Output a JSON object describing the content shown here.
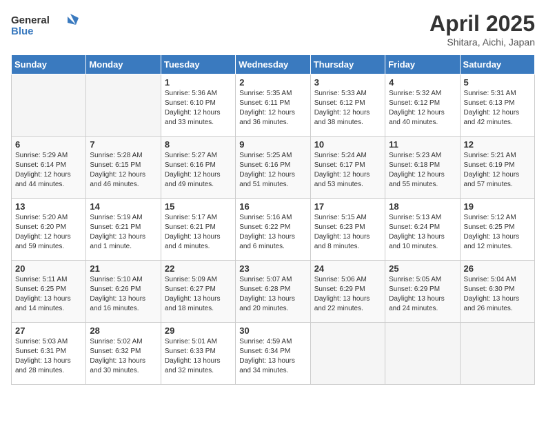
{
  "header": {
    "logo_general": "General",
    "logo_blue": "Blue",
    "title": "April 2025",
    "subtitle": "Shitara, Aichi, Japan"
  },
  "weekdays": [
    "Sunday",
    "Monday",
    "Tuesday",
    "Wednesday",
    "Thursday",
    "Friday",
    "Saturday"
  ],
  "weeks": [
    [
      {
        "day": "",
        "info": ""
      },
      {
        "day": "",
        "info": ""
      },
      {
        "day": "1",
        "info": "Sunrise: 5:36 AM\nSunset: 6:10 PM\nDaylight: 12 hours and 33 minutes."
      },
      {
        "day": "2",
        "info": "Sunrise: 5:35 AM\nSunset: 6:11 PM\nDaylight: 12 hours and 36 minutes."
      },
      {
        "day": "3",
        "info": "Sunrise: 5:33 AM\nSunset: 6:12 PM\nDaylight: 12 hours and 38 minutes."
      },
      {
        "day": "4",
        "info": "Sunrise: 5:32 AM\nSunset: 6:12 PM\nDaylight: 12 hours and 40 minutes."
      },
      {
        "day": "5",
        "info": "Sunrise: 5:31 AM\nSunset: 6:13 PM\nDaylight: 12 hours and 42 minutes."
      }
    ],
    [
      {
        "day": "6",
        "info": "Sunrise: 5:29 AM\nSunset: 6:14 PM\nDaylight: 12 hours and 44 minutes."
      },
      {
        "day": "7",
        "info": "Sunrise: 5:28 AM\nSunset: 6:15 PM\nDaylight: 12 hours and 46 minutes."
      },
      {
        "day": "8",
        "info": "Sunrise: 5:27 AM\nSunset: 6:16 PM\nDaylight: 12 hours and 49 minutes."
      },
      {
        "day": "9",
        "info": "Sunrise: 5:25 AM\nSunset: 6:16 PM\nDaylight: 12 hours and 51 minutes."
      },
      {
        "day": "10",
        "info": "Sunrise: 5:24 AM\nSunset: 6:17 PM\nDaylight: 12 hours and 53 minutes."
      },
      {
        "day": "11",
        "info": "Sunrise: 5:23 AM\nSunset: 6:18 PM\nDaylight: 12 hours and 55 minutes."
      },
      {
        "day": "12",
        "info": "Sunrise: 5:21 AM\nSunset: 6:19 PM\nDaylight: 12 hours and 57 minutes."
      }
    ],
    [
      {
        "day": "13",
        "info": "Sunrise: 5:20 AM\nSunset: 6:20 PM\nDaylight: 12 hours and 59 minutes."
      },
      {
        "day": "14",
        "info": "Sunrise: 5:19 AM\nSunset: 6:21 PM\nDaylight: 13 hours and 1 minute."
      },
      {
        "day": "15",
        "info": "Sunrise: 5:17 AM\nSunset: 6:21 PM\nDaylight: 13 hours and 4 minutes."
      },
      {
        "day": "16",
        "info": "Sunrise: 5:16 AM\nSunset: 6:22 PM\nDaylight: 13 hours and 6 minutes."
      },
      {
        "day": "17",
        "info": "Sunrise: 5:15 AM\nSunset: 6:23 PM\nDaylight: 13 hours and 8 minutes."
      },
      {
        "day": "18",
        "info": "Sunrise: 5:13 AM\nSunset: 6:24 PM\nDaylight: 13 hours and 10 minutes."
      },
      {
        "day": "19",
        "info": "Sunrise: 5:12 AM\nSunset: 6:25 PM\nDaylight: 13 hours and 12 minutes."
      }
    ],
    [
      {
        "day": "20",
        "info": "Sunrise: 5:11 AM\nSunset: 6:25 PM\nDaylight: 13 hours and 14 minutes."
      },
      {
        "day": "21",
        "info": "Sunrise: 5:10 AM\nSunset: 6:26 PM\nDaylight: 13 hours and 16 minutes."
      },
      {
        "day": "22",
        "info": "Sunrise: 5:09 AM\nSunset: 6:27 PM\nDaylight: 13 hours and 18 minutes."
      },
      {
        "day": "23",
        "info": "Sunrise: 5:07 AM\nSunset: 6:28 PM\nDaylight: 13 hours and 20 minutes."
      },
      {
        "day": "24",
        "info": "Sunrise: 5:06 AM\nSunset: 6:29 PM\nDaylight: 13 hours and 22 minutes."
      },
      {
        "day": "25",
        "info": "Sunrise: 5:05 AM\nSunset: 6:29 PM\nDaylight: 13 hours and 24 minutes."
      },
      {
        "day": "26",
        "info": "Sunrise: 5:04 AM\nSunset: 6:30 PM\nDaylight: 13 hours and 26 minutes."
      }
    ],
    [
      {
        "day": "27",
        "info": "Sunrise: 5:03 AM\nSunset: 6:31 PM\nDaylight: 13 hours and 28 minutes."
      },
      {
        "day": "28",
        "info": "Sunrise: 5:02 AM\nSunset: 6:32 PM\nDaylight: 13 hours and 30 minutes."
      },
      {
        "day": "29",
        "info": "Sunrise: 5:01 AM\nSunset: 6:33 PM\nDaylight: 13 hours and 32 minutes."
      },
      {
        "day": "30",
        "info": "Sunrise: 4:59 AM\nSunset: 6:34 PM\nDaylight: 13 hours and 34 minutes."
      },
      {
        "day": "",
        "info": ""
      },
      {
        "day": "",
        "info": ""
      },
      {
        "day": "",
        "info": ""
      }
    ]
  ]
}
